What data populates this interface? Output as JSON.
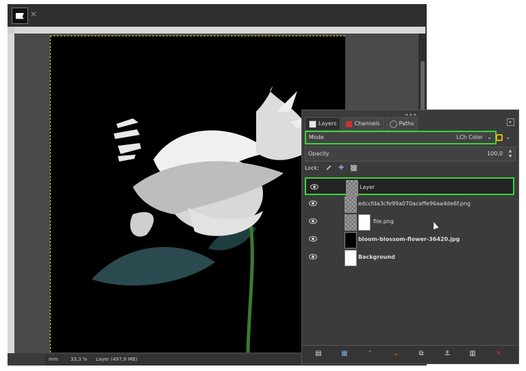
{
  "status": {
    "unit": "mm",
    "zoom": "33,3 %",
    "message": "Layer (497,9 MB)"
  },
  "layers_dock": {
    "tabs": [
      {
        "label": "Layers"
      },
      {
        "label": "Channels"
      },
      {
        "label": "Paths"
      }
    ],
    "mode": {
      "label": "Mode",
      "value": "LCh Color"
    },
    "opacity": {
      "label": "Opacity",
      "value": "100,0"
    },
    "lock_label": "Lock:",
    "layers": [
      {
        "name": "Layer"
      },
      {
        "name": "edccfda3cfe99a070aceffe96aa4de6f.png"
      },
      {
        "name": "file.png"
      },
      {
        "name": "bloom-blossom-flower-36420.jpg"
      },
      {
        "name": "Background"
      }
    ],
    "bottom_icons": [
      "new-layer-icon",
      "new-group-icon",
      "raise-icon",
      "lower-icon",
      "duplicate-icon",
      "anchor-icon",
      "merge-icon",
      "delete-icon"
    ]
  },
  "colors": {
    "selection_highlight": "#3bd43b",
    "canvas_boundary": "#d9d200"
  }
}
